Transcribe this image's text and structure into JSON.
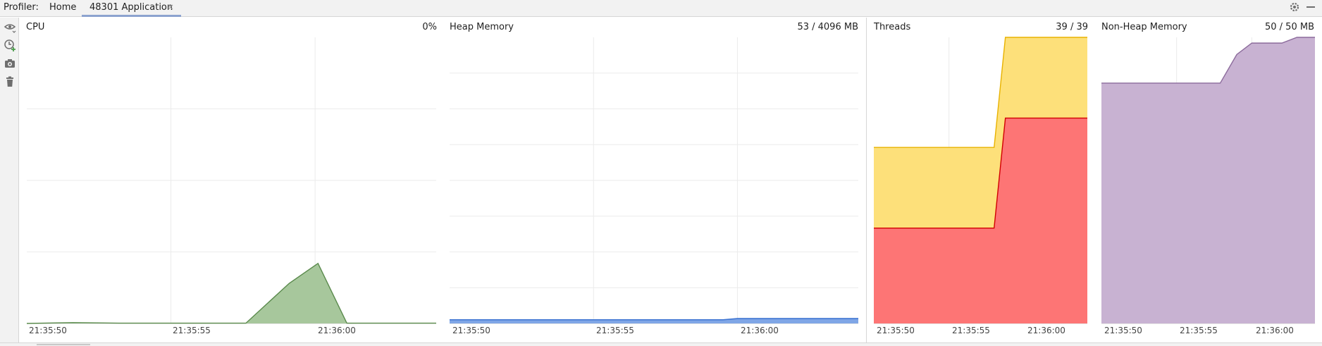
{
  "toolbar": {
    "profiler_label": "Profiler:",
    "home_tab": "Home",
    "app_tab": "48301 Application",
    "tab_close": "×",
    "settings_icon": "gear-icon",
    "minimize_icon": "minimize-icon"
  },
  "sidebar": {
    "items": [
      {
        "icon": "eye-icon"
      },
      {
        "icon": "add-session-icon"
      },
      {
        "icon": "camera-icon"
      },
      {
        "icon": "trash-icon"
      }
    ]
  },
  "panels": {
    "cpu": {
      "title": "CPU",
      "value": "0%"
    },
    "heap": {
      "title": "Heap Memory",
      "value": "53 / 4096 MB"
    },
    "threads": {
      "title": "Threads",
      "value": "39 / 39"
    },
    "nonheap": {
      "title": "Non-Heap Memory",
      "value": "50 / 50 MB"
    }
  },
  "colors": {
    "cpu": "#a7c79c",
    "cpu_line": "#5a8a4c",
    "heap": "#7fa6e6",
    "heap_line": "#3d74d2",
    "threads_total": "#fde07a",
    "threads_total_line": "#e8b200",
    "threads_active": "#fd7575",
    "threads_active_line": "#d10000",
    "nonheap": "#c8b2d2",
    "nonheap_line": "#8c6b9c",
    "grid": "#ebebeb"
  },
  "chart_data": [
    {
      "type": "area",
      "id": "cpu",
      "title": "CPU",
      "xlabel": "",
      "ylabel": "",
      "x_ticks": [
        "21:35:50",
        "21:35:55",
        "21:36:00"
      ],
      "ylim": [
        0,
        100
      ],
      "series": [
        {
          "x": [
            0.0,
            1.6,
            3.2,
            4.8,
            6.4,
            7.6,
            9.1,
            10.1,
            11.1,
            12.9,
            14.2
          ],
          "values": [
            0.0,
            0.3,
            0.1,
            0.1,
            0.1,
            0.1,
            14,
            21,
            0.1,
            0.1,
            0.1
          ]
        }
      ]
    },
    {
      "type": "area",
      "id": "heap",
      "title": "Heap Memory",
      "xlabel": "",
      "ylabel": "",
      "x_ticks": [
        "21:35:50",
        "21:35:55",
        "21:36:00"
      ],
      "ylim": [
        0,
        4096
      ],
      "series": [
        {
          "x": [
            0.0,
            5.0,
            9.5,
            10.0,
            14.2
          ],
          "values": [
            53,
            53,
            53,
            70,
            70
          ]
        }
      ]
    },
    {
      "type": "area",
      "id": "threads",
      "title": "Threads",
      "xlabel": "",
      "ylabel": "",
      "x_ticks": [
        "21:35:50",
        "21:35:55",
        "21:36:00"
      ],
      "ylim": [
        0,
        39
      ],
      "series": [
        {
          "name": "",
          "x": [
            0.0,
            8.0,
            8.75,
            14.2
          ],
          "values": [
            24,
            24,
            39,
            39
          ]
        },
        {
          "name": "",
          "x": [
            0.0,
            8.0,
            8.75,
            14.2
          ],
          "values": [
            13,
            13,
            28,
            28
          ]
        }
      ]
    },
    {
      "type": "area",
      "id": "nonheap",
      "title": "Non-Heap Memory",
      "xlabel": "",
      "ylabel": "",
      "x_ticks": [
        "21:35:50",
        "21:35:55",
        "21:36:00"
      ],
      "ylim": [
        0,
        50
      ],
      "series": [
        {
          "x": [
            0.0,
            5.0,
            7.9,
            9.0,
            10.0,
            12.0,
            13.0,
            14.2
          ],
          "values": [
            42,
            42,
            42,
            47,
            49,
            49,
            50,
            50
          ]
        }
      ]
    }
  ]
}
